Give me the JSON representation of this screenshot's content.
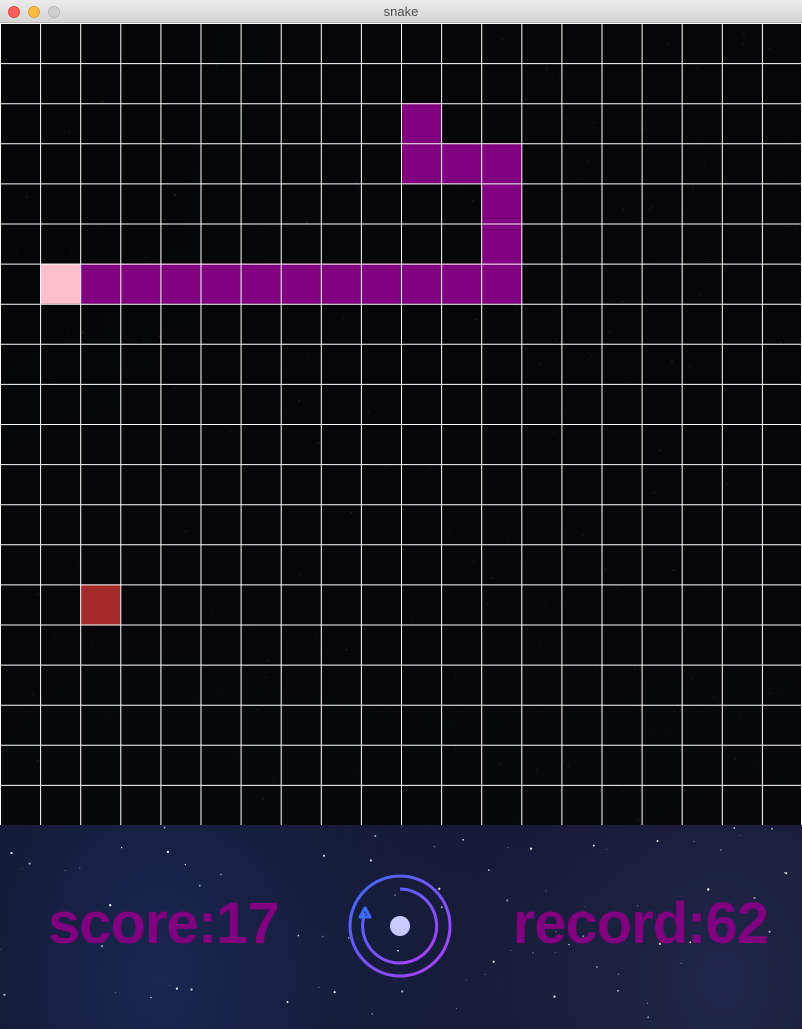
{
  "window": {
    "title": "snake"
  },
  "board": {
    "columns": 20,
    "rows": 20,
    "snake_head": {
      "col": 1,
      "row": 6
    },
    "snake_body": [
      {
        "col": 2,
        "row": 6
      },
      {
        "col": 3,
        "row": 6
      },
      {
        "col": 4,
        "row": 6
      },
      {
        "col": 5,
        "row": 6
      },
      {
        "col": 6,
        "row": 6
      },
      {
        "col": 7,
        "row": 6
      },
      {
        "col": 8,
        "row": 6
      },
      {
        "col": 9,
        "row": 6
      },
      {
        "col": 10,
        "row": 6
      },
      {
        "col": 11,
        "row": 6
      },
      {
        "col": 12,
        "row": 6
      },
      {
        "col": 12,
        "row": 5
      },
      {
        "col": 12,
        "row": 4
      },
      {
        "col": 12,
        "row": 3
      },
      {
        "col": 11,
        "row": 3
      },
      {
        "col": 10,
        "row": 3
      },
      {
        "col": 10,
        "row": 2
      }
    ],
    "food": {
      "col": 2,
      "row": 14
    }
  },
  "hud": {
    "score_text": "score:17",
    "record_text": "record:62",
    "restart_icon": "restart-icon"
  },
  "colors": {
    "snake_body": "#800080",
    "snake_head": "#ffc0cb",
    "food": "#a52a2a",
    "grid_line": "#ffffff",
    "cell": "#050507",
    "hud_text": "#800080",
    "restart_ring_start": "#3b6cff",
    "restart_ring_end": "#b33cff",
    "restart_dot": "#c7c9ff"
  }
}
